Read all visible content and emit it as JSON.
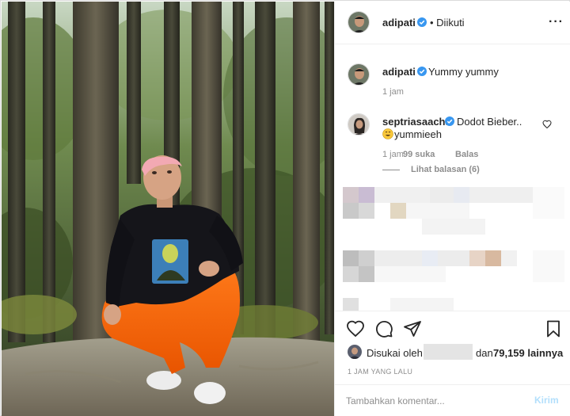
{
  "post": {
    "author": "adipati",
    "follow_status": "Diikuti",
    "more_icon": "more-options-icon"
  },
  "caption": {
    "username": "adipati",
    "text": "Yummy yummy",
    "time": "1 jam"
  },
  "comment": {
    "username": "septriasaacha",
    "text": "Dodot Bieber..",
    "text2": "yummieeh",
    "time": "1 jam",
    "likes": "99 suka",
    "reply_label": "Balas",
    "view_replies": "Lihat balasan (6)"
  },
  "likes": {
    "prefix": "Disukai oleh",
    "middle": "dan",
    "count_text": "79,159 lainnya"
  },
  "post_time": "1 JAM YANG LALU",
  "comment_box": {
    "placeholder": "Tambahkan komentar...",
    "post_label": "Kirim"
  },
  "colors": {
    "verified": "#3897f0",
    "text": "#262626",
    "muted": "#8e8e8e",
    "border": "#efefef",
    "post_button_disabled": "#b2dffc"
  },
  "icons": [
    "verified-badge-icon",
    "heart-icon",
    "comment-icon",
    "share-icon",
    "bookmark-icon",
    "small-heart-icon",
    "smiling-emoji-icon"
  ]
}
